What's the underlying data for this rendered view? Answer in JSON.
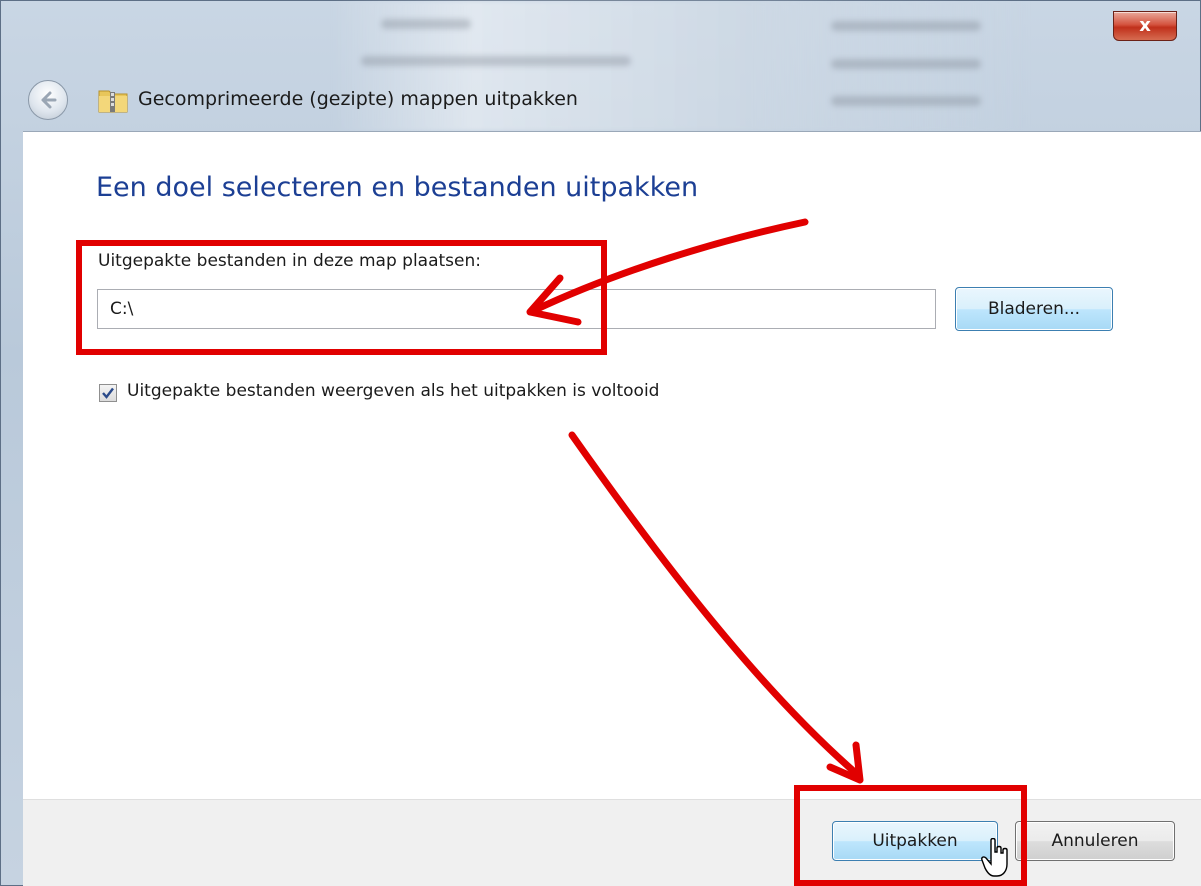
{
  "window": {
    "title": "Gecomprimeerde (gezipte) mappen uitpakken",
    "close_glyph": "x"
  },
  "content": {
    "heading": "Een doel selecteren en bestanden uitpakken",
    "path_label": "Uitgepakte bestanden in deze map plaatsen:",
    "path_value": "C:\\",
    "browse_label": "Bladeren...",
    "show_files_label": "Uitgepakte bestanden weergeven als het uitpakken is voltooid",
    "show_files_checked": true
  },
  "footer": {
    "extract_label": "Uitpakken",
    "cancel_label": "Annuleren"
  },
  "colors": {
    "heading": "#1c3f94",
    "annotation": "#e10000",
    "button_focus_border": "#3c7fb1"
  },
  "icons": [
    "back-arrow-icon",
    "zip-folder-icon",
    "close-icon",
    "checkmark-icon",
    "mouse-cursor-icon"
  ]
}
